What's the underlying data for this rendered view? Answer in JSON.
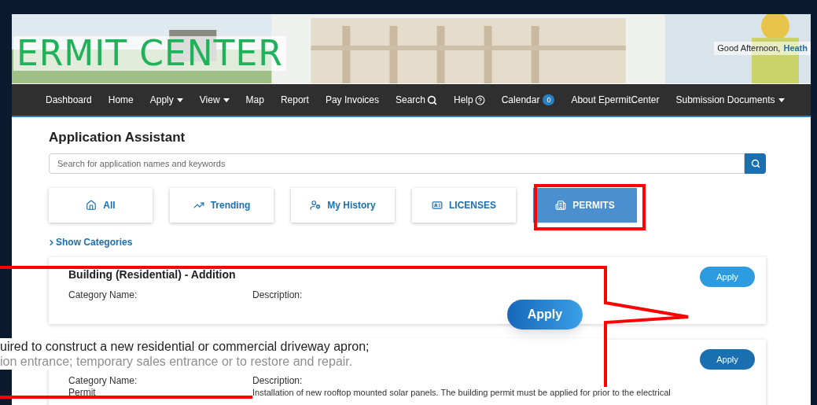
{
  "header": {
    "logo": "ERMIT CENTER",
    "greeting": "Good Afternoon,",
    "user": "Heath"
  },
  "nav": [
    {
      "label": "Dashboard",
      "kind": "link"
    },
    {
      "label": "Home",
      "kind": "link"
    },
    {
      "label": "Apply",
      "kind": "dropdown"
    },
    {
      "label": "View",
      "kind": "dropdown"
    },
    {
      "label": "Map",
      "kind": "link"
    },
    {
      "label": "Report",
      "kind": "link"
    },
    {
      "label": "Pay Invoices",
      "kind": "link"
    },
    {
      "label": "Search",
      "kind": "search"
    },
    {
      "label": "Help",
      "kind": "help"
    },
    {
      "label": "Calendar",
      "kind": "badge",
      "badge": "0"
    },
    {
      "label": "About EpermitCenter",
      "kind": "link"
    },
    {
      "label": "Submission Documents",
      "kind": "dropdown"
    }
  ],
  "assistant": {
    "title": "Application Assistant",
    "search": {
      "placeholder": "Search for application names and keywords"
    },
    "tabs": [
      {
        "label": "All",
        "selected": false
      },
      {
        "label": "Trending",
        "selected": false
      },
      {
        "label": "My History",
        "selected": false
      },
      {
        "label": "LICENSES",
        "selected": false
      },
      {
        "label": "PERMITS",
        "selected": true
      }
    ],
    "show_categories": "Show Categories",
    "cards": [
      {
        "title": "Building (Residential) - Addition",
        "category_label": "Category Name:",
        "description_label": "Description:",
        "button": "Apply"
      },
      {
        "category_label": "Category Name:",
        "category": "Permit",
        "description_label": "Description:",
        "description": "Installation of new rooftop mounted solar panels. The building permit must be applied for prior to the electrical",
        "button": "Apply"
      }
    ]
  },
  "callout": {
    "button": "Apply",
    "lines": [
      {
        "text": "uired to construct a new residential or commercial driveway apron;",
        "faded": false
      },
      {
        "text": "ion entrance; temporary sales entrance or to restore and repair.",
        "faded": true
      }
    ]
  }
}
